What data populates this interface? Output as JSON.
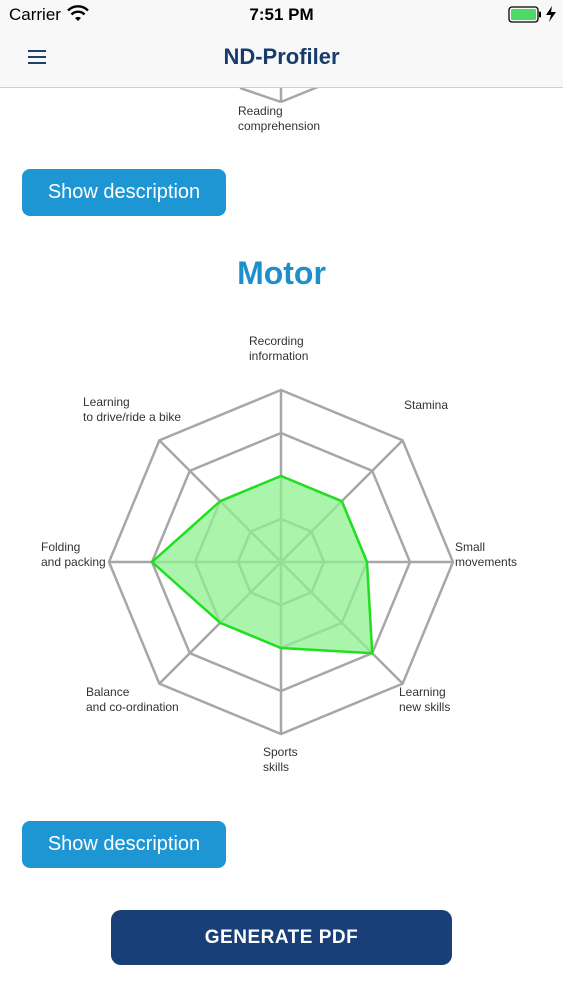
{
  "status_bar": {
    "carrier": "Carrier",
    "time": "7:51 PM",
    "wifi_icon": "wifi-icon",
    "battery_icon": "battery-icon",
    "charging_icon": "charging-bolt-icon"
  },
  "nav": {
    "title": "ND-Profiler",
    "menu_icon": "hamburger-menu-icon"
  },
  "previous_section": {
    "axis_label": "Reading\ncomprehension",
    "description_button": "Show description"
  },
  "motor_section": {
    "title": "Motor",
    "description_button": "Show description"
  },
  "chart_data": {
    "type": "radar",
    "levels": 4,
    "max": 4,
    "axes": [
      "Recording\ninformation",
      "Stamina",
      "Small\nmovements",
      "Learning\nnew skills",
      "Sports\nskills",
      "Balance\nand co-ordination",
      "Folding\nand packing",
      "Learning\nto drive/ride a bike"
    ],
    "values": [
      2,
      2,
      2,
      3,
      2,
      2,
      3,
      2
    ],
    "colors": {
      "grid": "#a7a7a7",
      "fill": "#8ff08f",
      "stroke": "#1fe01f"
    }
  },
  "footer": {
    "generate_button": "GENERATE PDF"
  }
}
